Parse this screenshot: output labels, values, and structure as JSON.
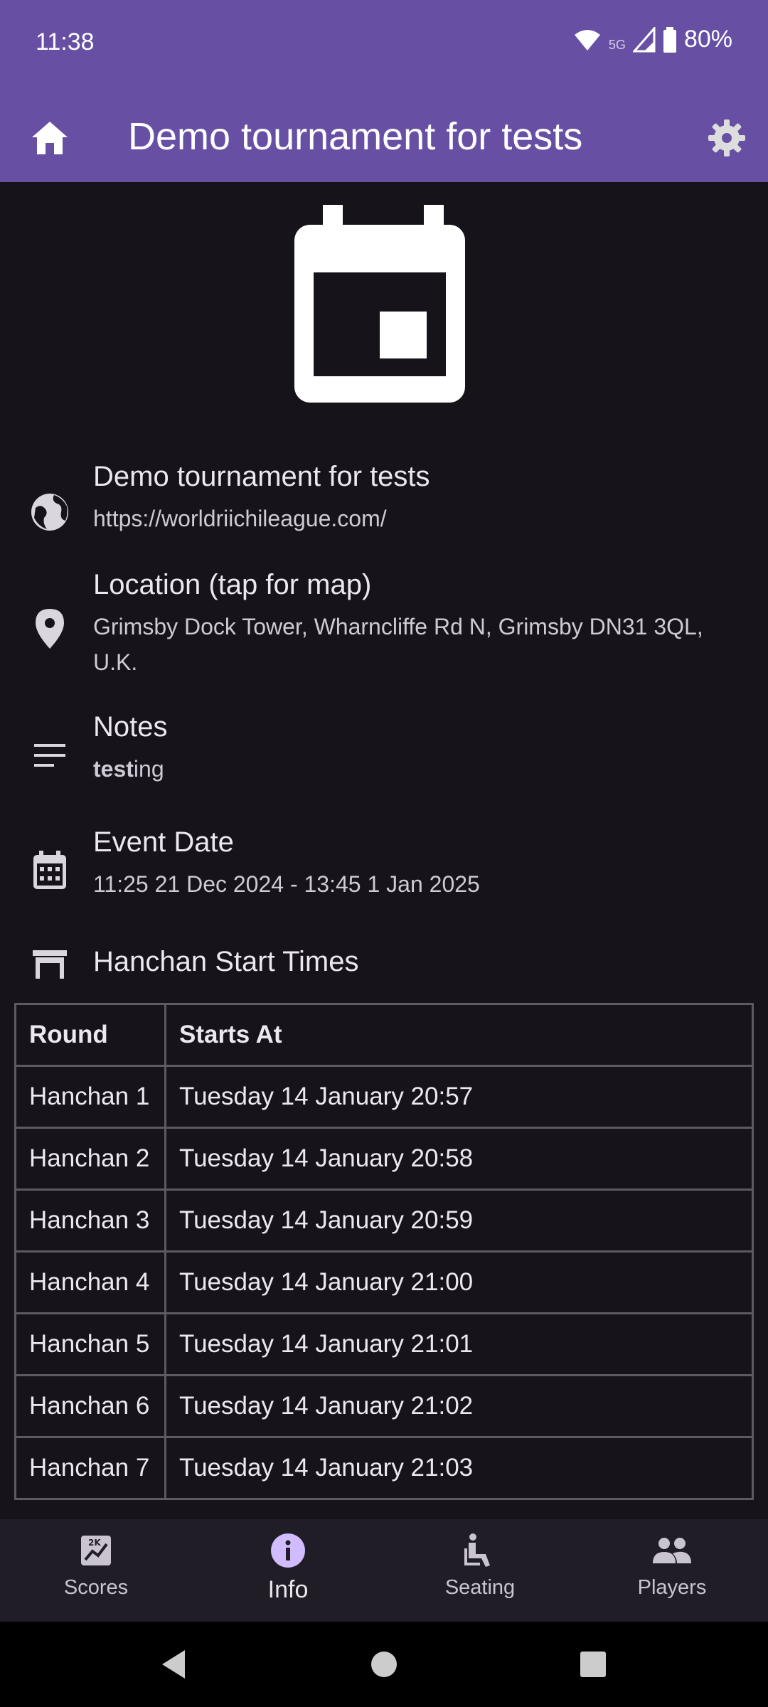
{
  "status": {
    "time": "11:38",
    "battery": "80%",
    "network": "5G"
  },
  "app_bar": {
    "title": "Demo tournament for tests",
    "home_icon": "home-icon",
    "settings_icon": "gear-icon"
  },
  "hero": {
    "icon": "calendar-icon"
  },
  "website": {
    "title": "Demo tournament for tests",
    "url": "https://worldriichileague.com/",
    "icon": "globe-icon"
  },
  "location": {
    "title": "Location (tap for map)",
    "address": "Grimsby Dock Tower, Wharncliffe Rd N, Grimsby DN31 3QL, U.K.",
    "icon": "map-pin-icon"
  },
  "notes": {
    "title": "Notes",
    "text_bold": "test",
    "text_rest": "ing",
    "icon": "notes-icon"
  },
  "event_date": {
    "title": "Event Date",
    "value": "11:25 21 Dec 2024 - 13:45 1 Jan 2025",
    "icon": "calendar-month-icon"
  },
  "hanchan": {
    "title": "Hanchan Start Times",
    "icon": "table-icon",
    "headers": [
      "Round",
      "Starts At"
    ],
    "rows": [
      [
        "Hanchan 1",
        "Tuesday 14 January 20:57"
      ],
      [
        "Hanchan 2",
        "Tuesday 14 January 20:58"
      ],
      [
        "Hanchan 3",
        "Tuesday 14 January 20:59"
      ],
      [
        "Hanchan 4",
        "Tuesday 14 January 21:00"
      ],
      [
        "Hanchan 5",
        "Tuesday 14 January 21:01"
      ],
      [
        "Hanchan 6",
        "Tuesday 14 January 21:02"
      ],
      [
        "Hanchan 7",
        "Tuesday 14 January 21:03"
      ]
    ]
  },
  "bottom_nav": {
    "items": [
      {
        "label": "Scores",
        "icon": "scores-icon"
      },
      {
        "label": "Info",
        "icon": "info-icon",
        "active": true
      },
      {
        "label": "Seating",
        "icon": "seating-icon"
      },
      {
        "label": "Players",
        "icon": "players-icon"
      }
    ]
  },
  "colors": {
    "accent": "#6750a4",
    "background": "#16131a",
    "nav_background": "#211d27"
  }
}
